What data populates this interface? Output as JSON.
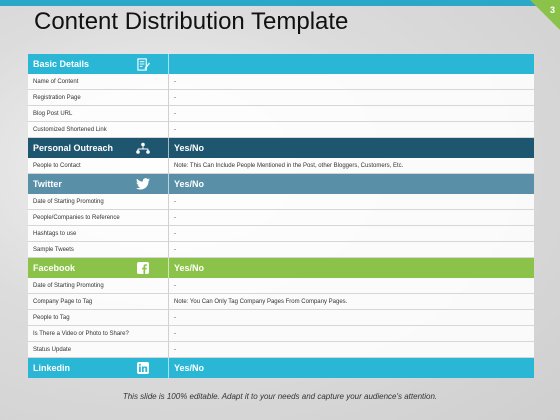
{
  "slide_number": "3",
  "title": "Content Distribution Template",
  "sections": {
    "basic": {
      "label": "Basic Details",
      "value": "",
      "icon": "edit-icon",
      "rows": [
        {
          "label": "Name of Content",
          "value": "-"
        },
        {
          "label": "Registration Page",
          "value": "-"
        },
        {
          "label": "Blog Post URL",
          "value": "-"
        },
        {
          "label": "Customized Shortened Link",
          "value": "-"
        }
      ]
    },
    "outreach": {
      "label": "Personal Outreach",
      "value": "Yes/No",
      "icon": "network-icon",
      "rows": [
        {
          "label": "People to Contact",
          "value": "Note: This Can Include People Mentioned in the Post, other Bloggers, Customers, Etc."
        }
      ]
    },
    "twitter": {
      "label": "Twitter",
      "value": "Yes/No",
      "icon": "twitter-icon",
      "rows": [
        {
          "label": "Date of Starting Promoting",
          "value": "-"
        },
        {
          "label": "People/Companies to Reference",
          "value": "-"
        },
        {
          "label": "Hashtags to use",
          "value": "-"
        },
        {
          "label": "Sample Tweets",
          "value": "-"
        }
      ]
    },
    "facebook": {
      "label": "Facebook",
      "value": "Yes/No",
      "icon": "facebook-icon",
      "rows": [
        {
          "label": "Date of Starting Promoting",
          "value": "-"
        },
        {
          "label": "Company Page to Tag",
          "value": "Note: You Can Only Tag Company Pages From Company Pages."
        },
        {
          "label": "People to Tag",
          "value": "-"
        },
        {
          "label": "Is There a Video or Photo to Share?",
          "value": "-"
        },
        {
          "label": "Status Update",
          "value": "-"
        }
      ]
    },
    "linkedin": {
      "label": "Linkedin",
      "value": "Yes/No",
      "icon": "linkedin-icon",
      "rows": []
    }
  },
  "footer": "This slide is 100% editable. Adapt it to your needs and capture your audience's attention.",
  "colors": {
    "teal": "#2ab7d6",
    "navy": "#1e5670",
    "steel": "#5a8fa8",
    "green": "#8bc34a"
  }
}
